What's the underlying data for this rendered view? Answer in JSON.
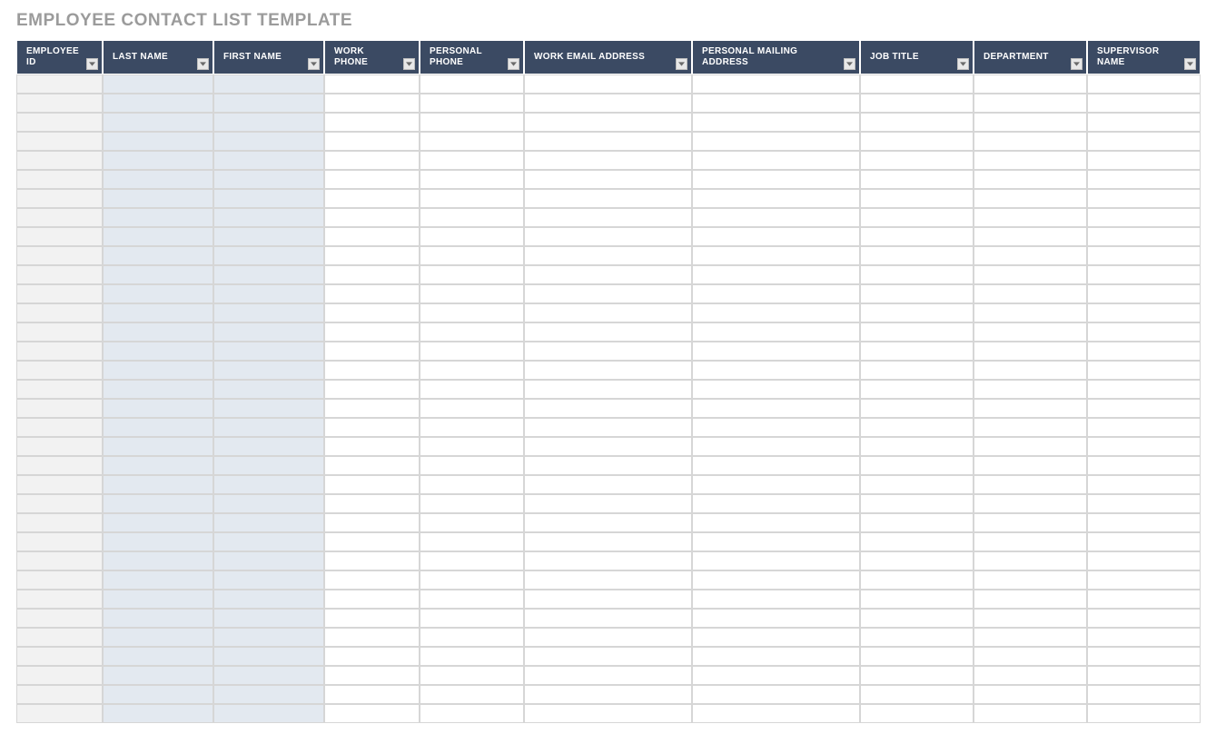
{
  "title": "EMPLOYEE CONTACT LIST TEMPLATE",
  "columns": [
    {
      "id": "employee_id",
      "label": "EMPLOYEE ID",
      "shade": "gray",
      "cls": "col-employee-id"
    },
    {
      "id": "last_name",
      "label": "LAST NAME",
      "shade": "blue",
      "cls": "col-last-name"
    },
    {
      "id": "first_name",
      "label": "FIRST NAME",
      "shade": "blue",
      "cls": "col-first-name"
    },
    {
      "id": "work_phone",
      "label": "WORK PHONE",
      "shade": "white",
      "cls": "col-work-phone"
    },
    {
      "id": "personal_phone",
      "label": "PERSONAL PHONE",
      "shade": "white",
      "cls": "col-personal-phone"
    },
    {
      "id": "work_email",
      "label": "WORK EMAIL ADDRESS",
      "shade": "white",
      "cls": "col-work-email"
    },
    {
      "id": "mailing_address",
      "label": "PERSONAL MAILING ADDRESS",
      "shade": "white",
      "cls": "col-mailing-address"
    },
    {
      "id": "job_title",
      "label": "JOB TITLE",
      "shade": "white",
      "cls": "col-job-title"
    },
    {
      "id": "department",
      "label": "DEPARTMENT",
      "shade": "white",
      "cls": "col-department"
    },
    {
      "id": "supervisor",
      "label": "SUPERVISOR NAME",
      "shade": "white",
      "cls": "col-supervisor"
    }
  ],
  "row_count": 34,
  "rows": []
}
